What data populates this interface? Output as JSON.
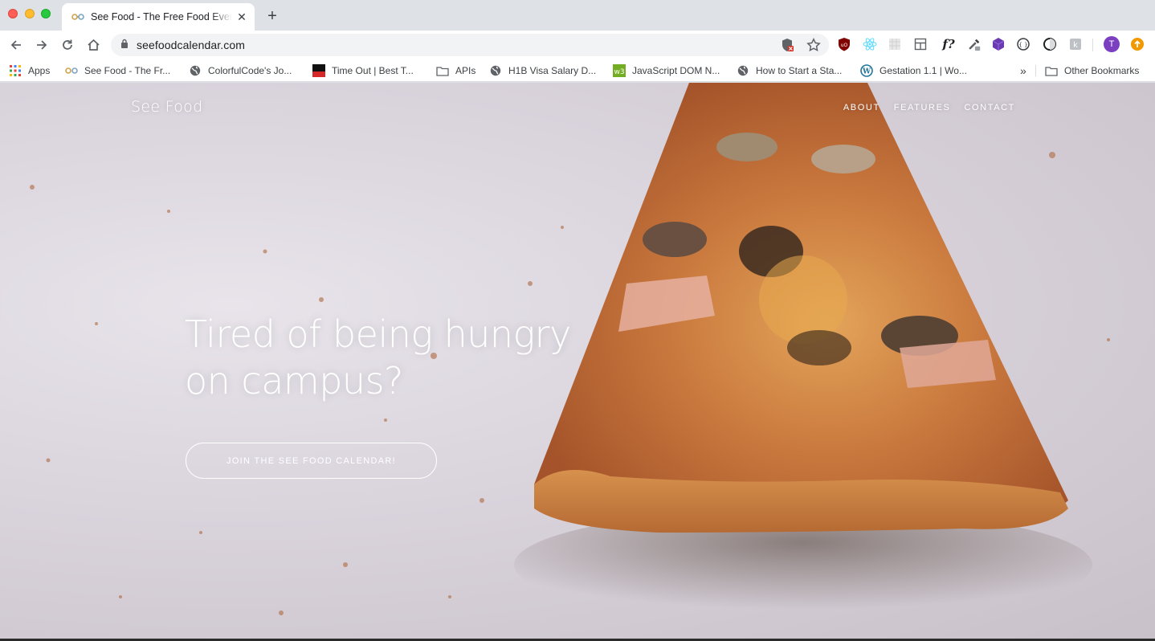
{
  "browser": {
    "tab": {
      "title": "See Food - The Free Food Event Calendar",
      "close_glyph": "✕"
    },
    "new_tab_glyph": "+",
    "url": "seefoodcalendar.com",
    "profile_initial": "T",
    "extension_label": "f?",
    "bookmarks": [
      {
        "label": "Apps",
        "icon": "apps-grid-icon"
      },
      {
        "label": "See Food - The Fr...",
        "icon": "glasses-icon"
      },
      {
        "label": "ColorfulCode's Jo...",
        "icon": "globe-icon"
      },
      {
        "label": "Time Out | Best T...",
        "icon": "timeout-icon"
      },
      {
        "label": "APIs",
        "icon": "folder-icon"
      },
      {
        "label": "H1B Visa Salary D...",
        "icon": "globe-icon"
      },
      {
        "label": "JavaScript DOM N...",
        "icon": "w3-icon"
      },
      {
        "label": "How to Start a Sta...",
        "icon": "globe-icon"
      },
      {
        "label": "Gestation 1.1 | Wo...",
        "icon": "wordpress-icon"
      }
    ],
    "overflow_glyph": "»",
    "other_bookmarks": "Other Bookmarks"
  },
  "site": {
    "brand": "See Food",
    "nav": [
      "ABOUT",
      "FEATURES",
      "CONTACT"
    ],
    "headline_line1": "Tired of being hungry",
    "headline_line2": "on campus?",
    "cta_label": "JOIN THE SEE FOOD CALENDAR!"
  },
  "colors": {
    "accent_profile": "#7b3fbf",
    "hero_text": "#ffffff"
  }
}
